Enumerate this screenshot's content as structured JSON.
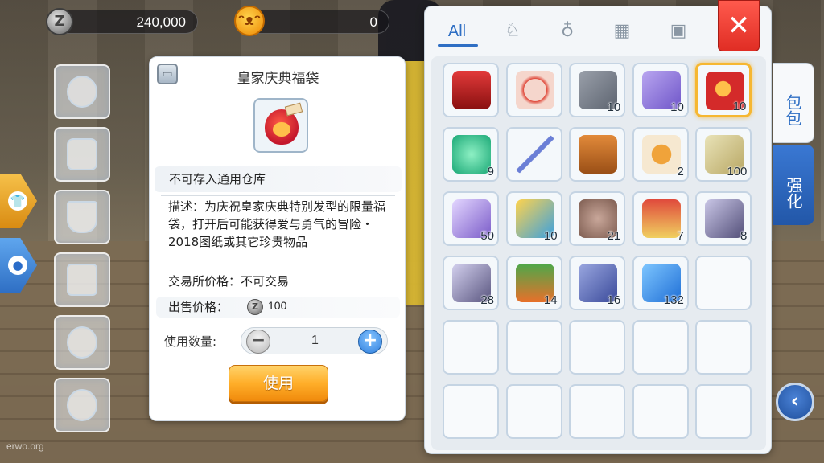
{
  "currency": {
    "zeny_icon": "zeny-coin-icon",
    "zeny": "240,000",
    "cat_icon": "cat-coin-icon",
    "cat": "0"
  },
  "detail": {
    "title": "皇家庆典福袋",
    "storage_note": "不可存入通用仓库",
    "description": "描述：为庆祝皇家庆典特别发型的限量福袋，打开后可能获得爱与勇气的冒险・2018图纸或其它珍贵物品",
    "exchange_price": "交易所价格：不可交易",
    "sell_label": "出售价格：",
    "sell_price": "100",
    "qty_label": "使用数量:",
    "qty_value": "1",
    "use_label": "使用"
  },
  "bag": {
    "tab_all": "All",
    "tab_icons": [
      "shirt-icon",
      "potion-icon",
      "grid-icon",
      "card-icon"
    ],
    "side_tab_bag": "包包",
    "side_tab_enhance": "强化",
    "items": [
      {
        "icon": "red-dress-icon",
        "count": ""
      },
      {
        "icon": "forbidden-hand-icon",
        "count": ""
      },
      {
        "icon": "gray-box-icon",
        "count": "10"
      },
      {
        "icon": "ticket-icon",
        "count": "10"
      },
      {
        "icon": "lucky-bag-icon",
        "count": "10",
        "selected": true
      },
      {
        "icon": "green-orb-icon",
        "count": "9"
      },
      {
        "icon": "magic-wand-icon",
        "count": ""
      },
      {
        "icon": "backpack-icon",
        "count": ""
      },
      {
        "icon": "winged-badge-icon",
        "count": "2"
      },
      {
        "icon": "cheese-icon",
        "count": "100"
      },
      {
        "icon": "purple-crystal-icon",
        "count": "50"
      },
      {
        "icon": "gold-box-icon",
        "count": "10"
      },
      {
        "icon": "cat-coin-icon",
        "count": "21"
      },
      {
        "icon": "gift-box-icon",
        "count": "7"
      },
      {
        "icon": "ore-icon",
        "count": "8"
      },
      {
        "icon": "silver-ore-icon",
        "count": "28"
      },
      {
        "icon": "flower-tray-icon",
        "count": "14"
      },
      {
        "icon": "chain-icon",
        "count": "16"
      },
      {
        "icon": "blue-ticket-icon",
        "count": "132"
      }
    ]
  },
  "watermark": "erwo.org",
  "colors": {
    "accent_blue": "#2f6fc4",
    "use_button": "#ffae29",
    "close_red": "#e02d24",
    "selected_border": "#f6b731"
  }
}
